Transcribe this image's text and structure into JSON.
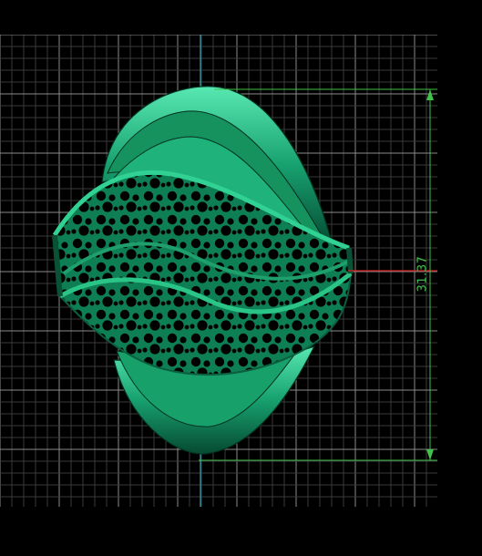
{
  "viewport": {
    "background": "#000000",
    "grid_minor_color": "#3a3a3a",
    "grid_major_color": "#8a8a8a",
    "axis_vertical_color": "#2aa7b8",
    "axis_horizontal_color": "#d42020"
  },
  "model": {
    "name": "filigree-ring-icon",
    "body_color": "#0f8a5c",
    "highlight_color": "#4fe0a8",
    "shadow_color": "#04402a"
  },
  "dimension": {
    "value": "31.37",
    "color": "#3ec24a"
  }
}
